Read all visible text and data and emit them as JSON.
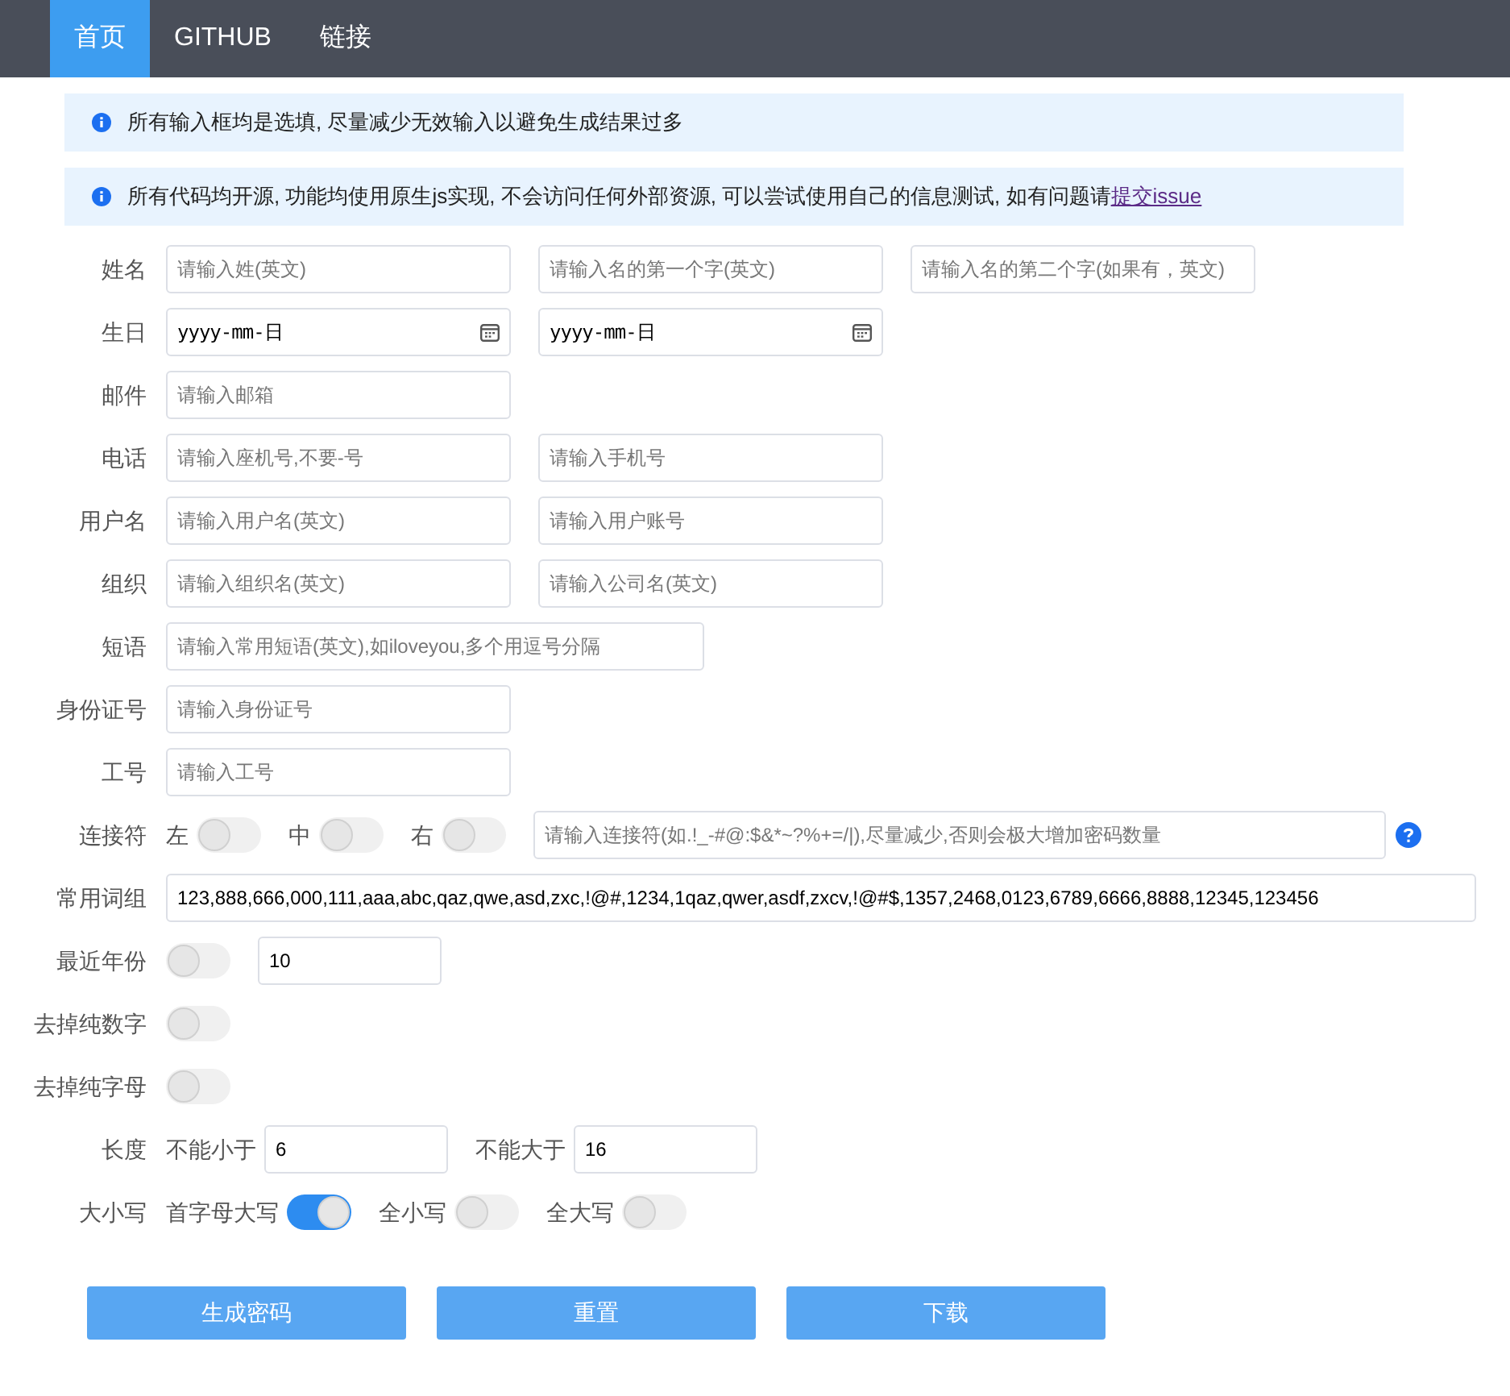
{
  "nav": [
    {
      "label": "首页",
      "selected": true
    },
    {
      "label": "GITHUB",
      "selected": false
    },
    {
      "label": "链接",
      "selected": false
    }
  ],
  "notices": [
    {
      "text": "所有输入框均是选填, 尽量减少无效输入以避免生成结果过多"
    },
    {
      "text": "所有代码均开源, 功能均使用原生js实现, 不会访问任何外部资源, 可以尝试使用自己的信息测试, 如有问题请",
      "link": "提交issue"
    }
  ],
  "rows": [
    {
      "label": "姓名",
      "items": [
        {
          "kind": "input",
          "placeholder": "请输入姓(英文)"
        },
        {
          "kind": "input",
          "placeholder": "请输入名的第一个字(英文)"
        },
        {
          "kind": "input",
          "placeholder": "请输入名的第二个字(如果有，英文)"
        }
      ]
    },
    {
      "label": "生日",
      "items": [
        {
          "kind": "date",
          "value": "yyyy-mm-日"
        },
        {
          "kind": "date",
          "value": "yyyy-mm-日"
        }
      ]
    },
    {
      "label": "邮件",
      "items": [
        {
          "kind": "input",
          "placeholder": "请输入邮箱"
        }
      ]
    },
    {
      "label": "电话",
      "items": [
        {
          "kind": "input",
          "placeholder": "请输入座机号,不要-号"
        },
        {
          "kind": "input",
          "placeholder": "请输入手机号"
        }
      ]
    },
    {
      "label": "用户名",
      "items": [
        {
          "kind": "input",
          "placeholder": "请输入用户名(英文)"
        },
        {
          "kind": "input",
          "placeholder": "请输入用户账号"
        }
      ]
    },
    {
      "label": "组织",
      "items": [
        {
          "kind": "input",
          "placeholder": "请输入组织名(英文)"
        },
        {
          "kind": "input",
          "placeholder": "请输入公司名(英文)"
        }
      ]
    },
    {
      "label": "短语",
      "items": [
        {
          "kind": "long-input",
          "placeholder": "请输入常用短语(英文),如iloveyou,多个用逗号分隔"
        }
      ]
    },
    {
      "label": "身份证号",
      "items": [
        {
          "kind": "input",
          "placeholder": "请输入身份证号"
        }
      ]
    },
    {
      "label": "工号",
      "items": [
        {
          "kind": "input",
          "placeholder": "请输入工号"
        }
      ]
    },
    {
      "label": "连接符",
      "items": [
        {
          "kind": "caption",
          "text": "左"
        },
        {
          "kind": "switch",
          "on": false
        },
        {
          "kind": "caption",
          "text": "中"
        },
        {
          "kind": "switch",
          "on": false
        },
        {
          "kind": "caption",
          "text": "右"
        },
        {
          "kind": "switch",
          "on": false
        },
        {
          "kind": "wide-input",
          "placeholder": "请输入连接符(如.!_-#@:$&*~?%+=/|),尽量减少,否则会极大增加密码数量"
        },
        {
          "kind": "help"
        }
      ]
    },
    {
      "label": "常用词组",
      "items": [
        {
          "kind": "wide-input",
          "value": "123,888,666,000,111,aaa,abc,qaz,qwe,asd,zxc,!@#,1234,1qaz,qwer,asdf,zxcv,!@#$,1357,2468,0123,6789,6666,8888,12345,123456"
        }
      ]
    },
    {
      "label": "最近年份",
      "items": [
        {
          "kind": "switch",
          "on": false
        },
        {
          "kind": "short-input",
          "value": "10"
        }
      ]
    },
    {
      "label": "去掉纯数字",
      "items": [
        {
          "kind": "switch",
          "on": false
        }
      ]
    },
    {
      "label": "去掉纯字母",
      "items": [
        {
          "kind": "switch",
          "on": false
        }
      ]
    },
    {
      "label": "长度",
      "items": [
        {
          "kind": "caption",
          "text": "不能小于"
        },
        {
          "kind": "short-input",
          "value": "6"
        },
        {
          "kind": "caption",
          "text": "不能大于"
        },
        {
          "kind": "short-input",
          "value": "16"
        }
      ]
    },
    {
      "label": "大小写",
      "items": [
        {
          "kind": "caption",
          "text": "首字母大写"
        },
        {
          "kind": "switch",
          "on": true
        },
        {
          "kind": "caption",
          "text": "全小写"
        },
        {
          "kind": "switch",
          "on": false
        },
        {
          "kind": "caption",
          "text": "全大写"
        },
        {
          "kind": "switch",
          "on": false
        }
      ]
    }
  ],
  "buttons": [
    "生成密码",
    "重置",
    "下载"
  ]
}
